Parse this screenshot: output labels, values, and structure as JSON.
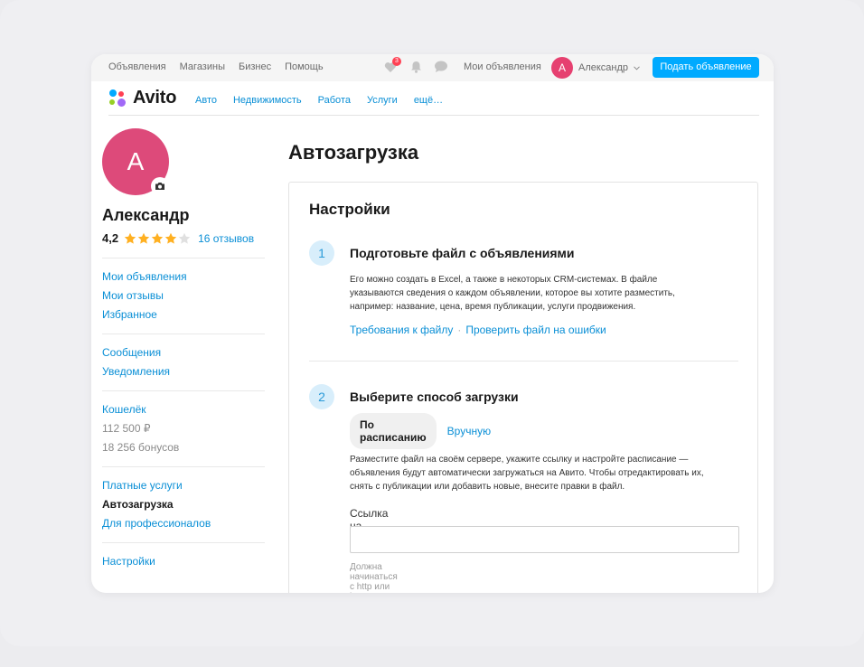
{
  "topbar": {
    "nav": [
      "Объявления",
      "Магазины",
      "Бизнес",
      "Помощь"
    ],
    "favorites_badge": "3",
    "my_ads": "Мои объявления",
    "user_initial": "А",
    "user_name": "Александр",
    "post_button": "Подать объявление"
  },
  "header": {
    "logo": "Avito",
    "categories": [
      "Авто",
      "Недвижимость",
      "Работа",
      "Услуги",
      "ещё…"
    ]
  },
  "profile": {
    "initial": "А",
    "name": "Александр",
    "rating": "4,2",
    "stars_filled": 4,
    "stars_total": 5,
    "reviews": "16 отзывов"
  },
  "sidebar": {
    "group1": [
      "Мои объявления",
      "Мои отзывы",
      "Избранное"
    ],
    "group2": [
      "Сообщения",
      "Уведомления"
    ],
    "wallet_label": "Кошелёк",
    "wallet_balance": "112 500 ₽",
    "wallet_bonus": "18 256 бонусов",
    "paid_services": "Платные услуги",
    "autoload": "Автозагрузка",
    "for_pros": "Для профессионалов",
    "settings": "Настройки"
  },
  "main": {
    "title": "Автозагрузка",
    "card_title": "Настройки",
    "step1": {
      "num": "1",
      "title": "Подготовьте файл с объявлениями",
      "text_lines": [
        "Его можно создать в Excel, а также в некоторых CRM-системах. В файле",
        "указываются сведения о каждом объявлении, которое вы хотите разместить,",
        "например: название, цена, время публикации, услуги продвижения."
      ],
      "link1": "Требования к файлу",
      "separator": "·",
      "link2": "Проверить файл на ошибки"
    },
    "step2": {
      "num": "2",
      "title": "Выберите способ загрузки",
      "option_active": "По расписанию",
      "option_inactive": "Вручную",
      "text_lines": [
        "Разместите файл на своём сервере, укажите ссылку и настройте расписание —",
        "объявления будут автоматически загружаться на Авито. Чтобы отредактировать их,",
        "снять с публикации или добавить новые, внесите правки в файл."
      ],
      "field_label": "Ссылка на файл",
      "field_value": "",
      "field_hint": "Должна начинаться с http или https"
    }
  },
  "colors": {
    "accent": "#00aaff",
    "link": "#0a8fd6",
    "avatar": "#dd4a7a",
    "star": "#ffb021"
  }
}
